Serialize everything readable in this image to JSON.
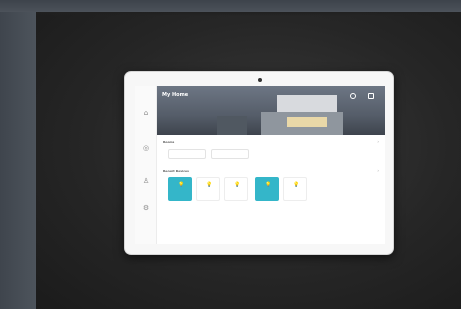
{
  "app": {
    "home_title": "My Home",
    "home_subtitle": ""
  },
  "sidebar": {
    "items": [
      {
        "icon": "home-icon",
        "glyph": "⌂"
      },
      {
        "icon": "scene-icon",
        "glyph": "◎"
      },
      {
        "icon": "person-icon",
        "glyph": "♙"
      },
      {
        "icon": "settings-icon",
        "glyph": "⚙"
      }
    ]
  },
  "hero": {
    "stats": [
      {
        "icon": "weather-icon",
        "label": ""
      },
      {
        "icon": "sun-icon",
        "label": ""
      }
    ]
  },
  "rooms": {
    "title": "Rooms",
    "more": "›",
    "chips": [
      {
        "label": ""
      },
      {
        "label": ""
      }
    ]
  },
  "devices": {
    "title": "Recent Devices",
    "more": "›",
    "tiles": [
      {
        "label": "",
        "on": true
      },
      {
        "label": "",
        "on": false
      },
      {
        "label": "",
        "on": false
      },
      {
        "label": "",
        "on": true
      },
      {
        "label": "",
        "on": false
      }
    ]
  },
  "colors": {
    "accent": "#34b6c9",
    "bulb_on": "#ffe48a"
  }
}
